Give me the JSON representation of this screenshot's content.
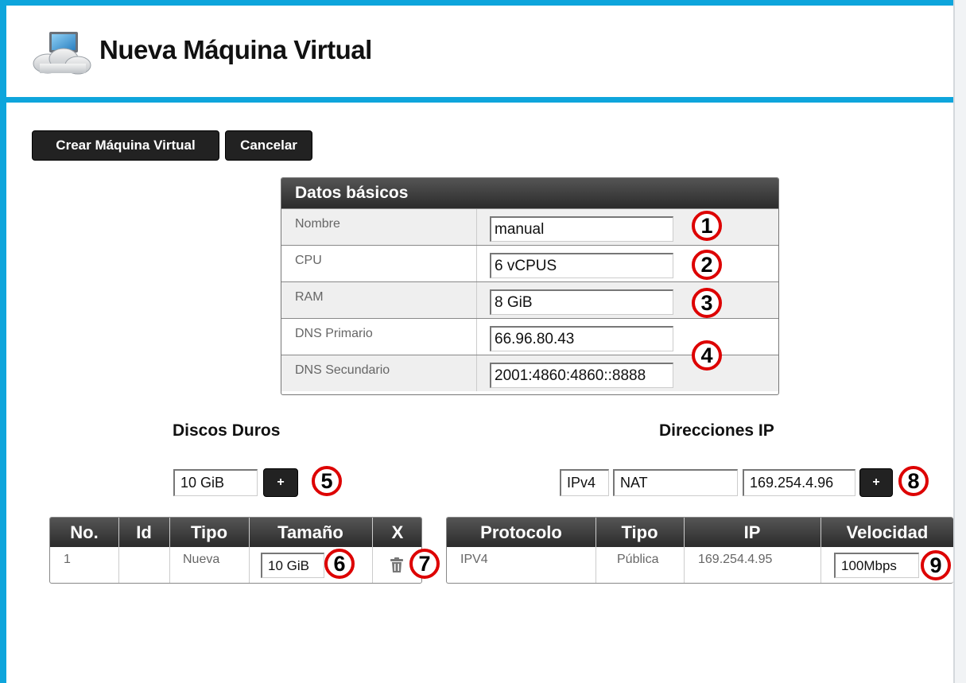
{
  "header": {
    "title": "Nueva Máquina Virtual",
    "logo_icon": "cloud-computer-icon"
  },
  "toolbar": {
    "create_label": "Crear Máquina Virtual",
    "cancel_label": "Cancelar"
  },
  "basic_data": {
    "title": "Datos básicos",
    "rows": [
      {
        "label": "Nombre",
        "value": "manual"
      },
      {
        "label": "CPU",
        "value": "6 vCPUS"
      },
      {
        "label": "RAM",
        "value": "8 GiB"
      },
      {
        "label": "DNS Primario",
        "value": "66.96.80.43"
      },
      {
        "label": "DNS Secundario",
        "value": "2001:4860:4860::8888"
      }
    ]
  },
  "disks": {
    "title": "Discos Duros",
    "new_size": "10 GiB",
    "add_label": "+",
    "columns": [
      "No.",
      "Id",
      "Tipo",
      "Tamaño",
      "X"
    ],
    "rows": [
      {
        "no": "1",
        "id": "",
        "tipo": "Nueva",
        "size": "10 GiB"
      }
    ]
  },
  "ips": {
    "title": "Direcciones IP",
    "new_protocol": "IPv4",
    "new_type": "NAT",
    "new_ip": "169.254.4.96",
    "add_label": "+",
    "columns": [
      "Protocolo",
      "Tipo",
      "IP",
      "Velocidad"
    ],
    "rows": [
      {
        "protocol": "IPV4",
        "tipo": "Pública",
        "ip": "169.254.4.95",
        "speed": "100Mbps"
      }
    ]
  },
  "callouts": [
    "1",
    "2",
    "3",
    "4",
    "5",
    "6",
    "7",
    "8",
    "9"
  ],
  "colors": {
    "accent": "#0ea5dc",
    "callout": "#dd0000",
    "header_dark": "#2b2b2b"
  }
}
